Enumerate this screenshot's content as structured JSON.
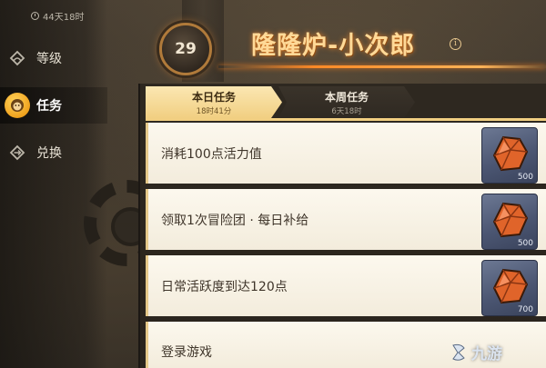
{
  "sidebar": {
    "timer": "44天18时",
    "items": [
      {
        "label": "等级",
        "icon": "diamond-icon",
        "active": false
      },
      {
        "label": "任务",
        "icon": "monkey-icon",
        "active": true
      },
      {
        "label": "兑换",
        "icon": "exchange-icon",
        "active": false
      }
    ]
  },
  "header": {
    "level": "29",
    "title": "隆隆炉-小次郎",
    "info_icon": "info-icon",
    "info_symbol": "i"
  },
  "tabs": [
    {
      "label": "本日任务",
      "sub": "18时41分",
      "active": true
    },
    {
      "label": "本周任务",
      "sub": "6天18时",
      "active": false
    }
  ],
  "tasks": [
    {
      "label": "消耗100点活力值",
      "reward_icon": "orange-gem-icon",
      "reward_qty": "500"
    },
    {
      "label": "领取1次冒险团 · 每日补给",
      "reward_icon": "orange-gem-icon",
      "reward_qty": "500"
    },
    {
      "label": "日常活跃度到达120点",
      "reward_icon": "orange-gem-icon",
      "reward_qty": "700"
    },
    {
      "label": "登录游戏",
      "reward_icon": "",
      "reward_qty": ""
    }
  ],
  "watermark": {
    "text": "九游"
  },
  "colors": {
    "title_glow": "#ff8a26",
    "tab_active": "#f1cf82",
    "reward_bg": "#4b5672",
    "gem": "#e0642a"
  }
}
